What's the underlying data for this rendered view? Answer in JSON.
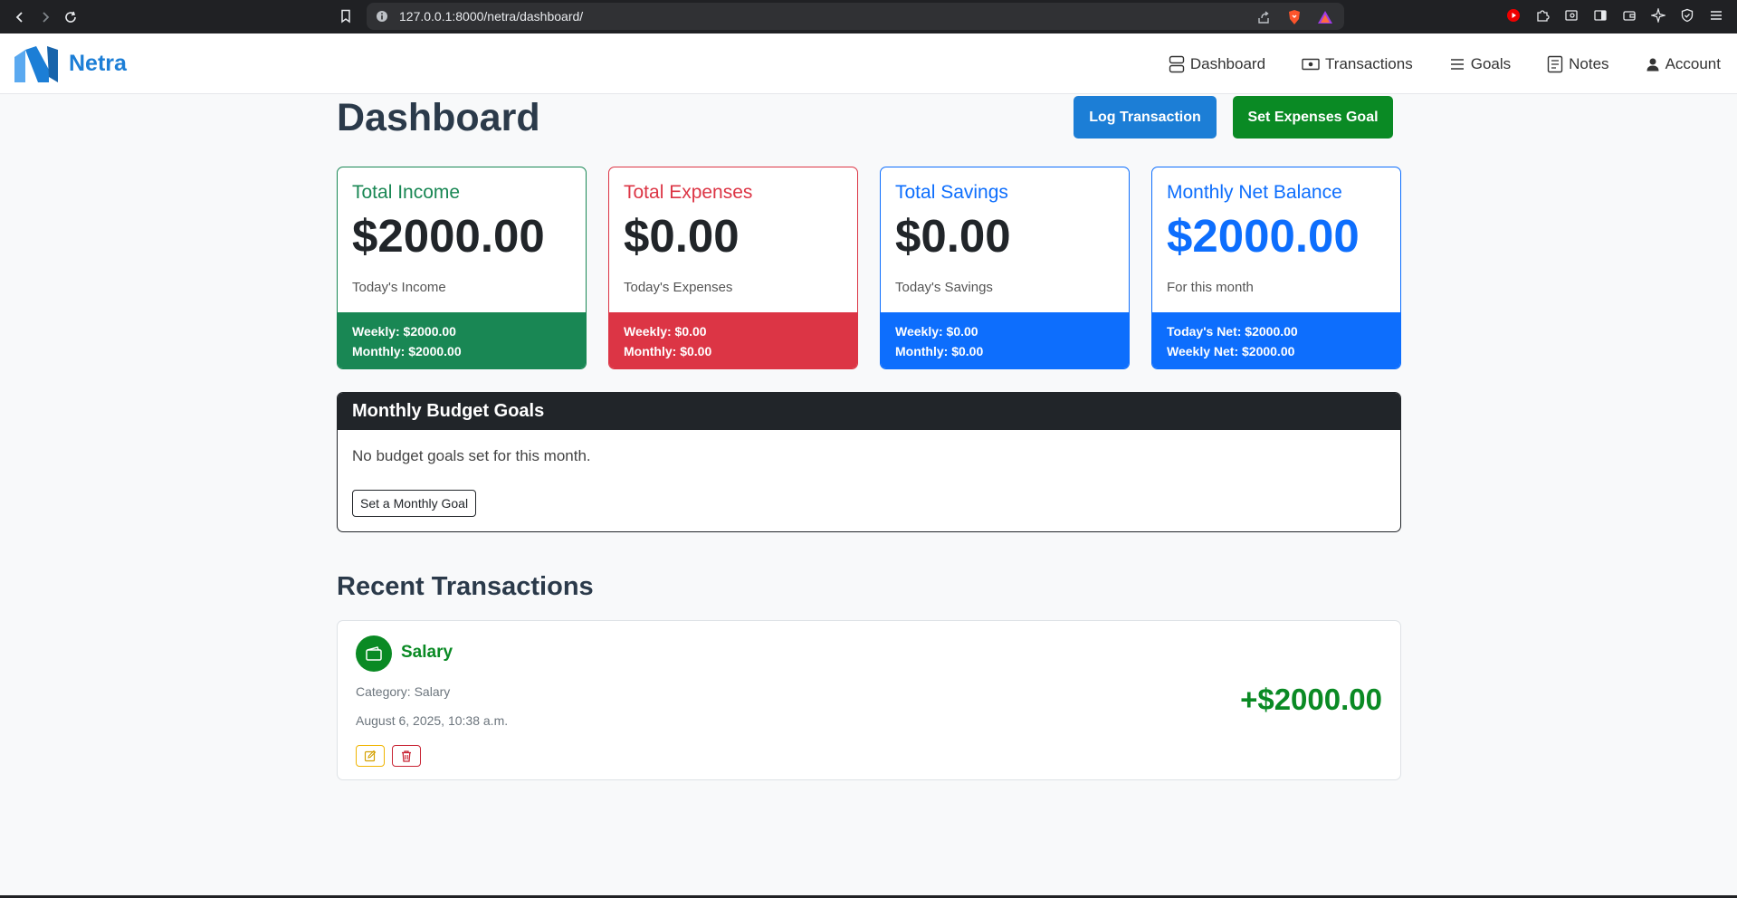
{
  "browser": {
    "url": "127.0.0.1:8000/netra/dashboard/"
  },
  "brand": {
    "name": "Netra",
    "color": "#1c7ed6"
  },
  "nav": {
    "items": [
      {
        "label": "Dashboard",
        "icon": "dashboard-icon"
      },
      {
        "label": "Transactions",
        "icon": "cash-icon"
      },
      {
        "label": "Goals",
        "icon": "list-icon"
      },
      {
        "label": "Notes",
        "icon": "notes-icon"
      },
      {
        "label": "Account",
        "icon": "person-icon"
      }
    ]
  },
  "page": {
    "title": "Dashboard",
    "log_transaction_label": "Log Transaction",
    "set_expenses_goal_label": "Set Expenses Goal"
  },
  "cards": {
    "income": {
      "title": "Total Income",
      "amount": "$2000.00",
      "subtitle": "Today's Income",
      "footer_line1": "Weekly: $2000.00",
      "footer_line2": "Monthly: $2000.00",
      "color": "#198754"
    },
    "expenses": {
      "title": "Total Expenses",
      "amount": "$0.00",
      "subtitle": "Today's Expenses",
      "footer_line1": "Weekly: $0.00",
      "footer_line2": "Monthly: $0.00",
      "color": "#dc3545"
    },
    "savings": {
      "title": "Total Savings",
      "amount": "$0.00",
      "subtitle": "Today's Savings",
      "footer_line1": "Weekly: $0.00",
      "footer_line2": "Monthly: $0.00",
      "color": "#0d6efd"
    },
    "net": {
      "title": "Monthly Net Balance",
      "amount": "$2000.00",
      "subtitle": "For this month",
      "footer_line1": "Today's Net: $2000.00",
      "footer_line2": "Weekly Net: $2000.00",
      "color": "#0d6efd"
    }
  },
  "budget_goals": {
    "title": "Monthly Budget Goals",
    "empty_message": "No budget goals set for this month.",
    "button_label": "Set a Monthly Goal"
  },
  "recent": {
    "title": "Recent Transactions",
    "transactions": [
      {
        "name": "Salary",
        "category": "Category: Salary",
        "date": "August 6, 2025, 10:38 a.m.",
        "amount": "+$2000.00",
        "icon": "wallet-icon",
        "color": "#0a8a24"
      }
    ]
  }
}
